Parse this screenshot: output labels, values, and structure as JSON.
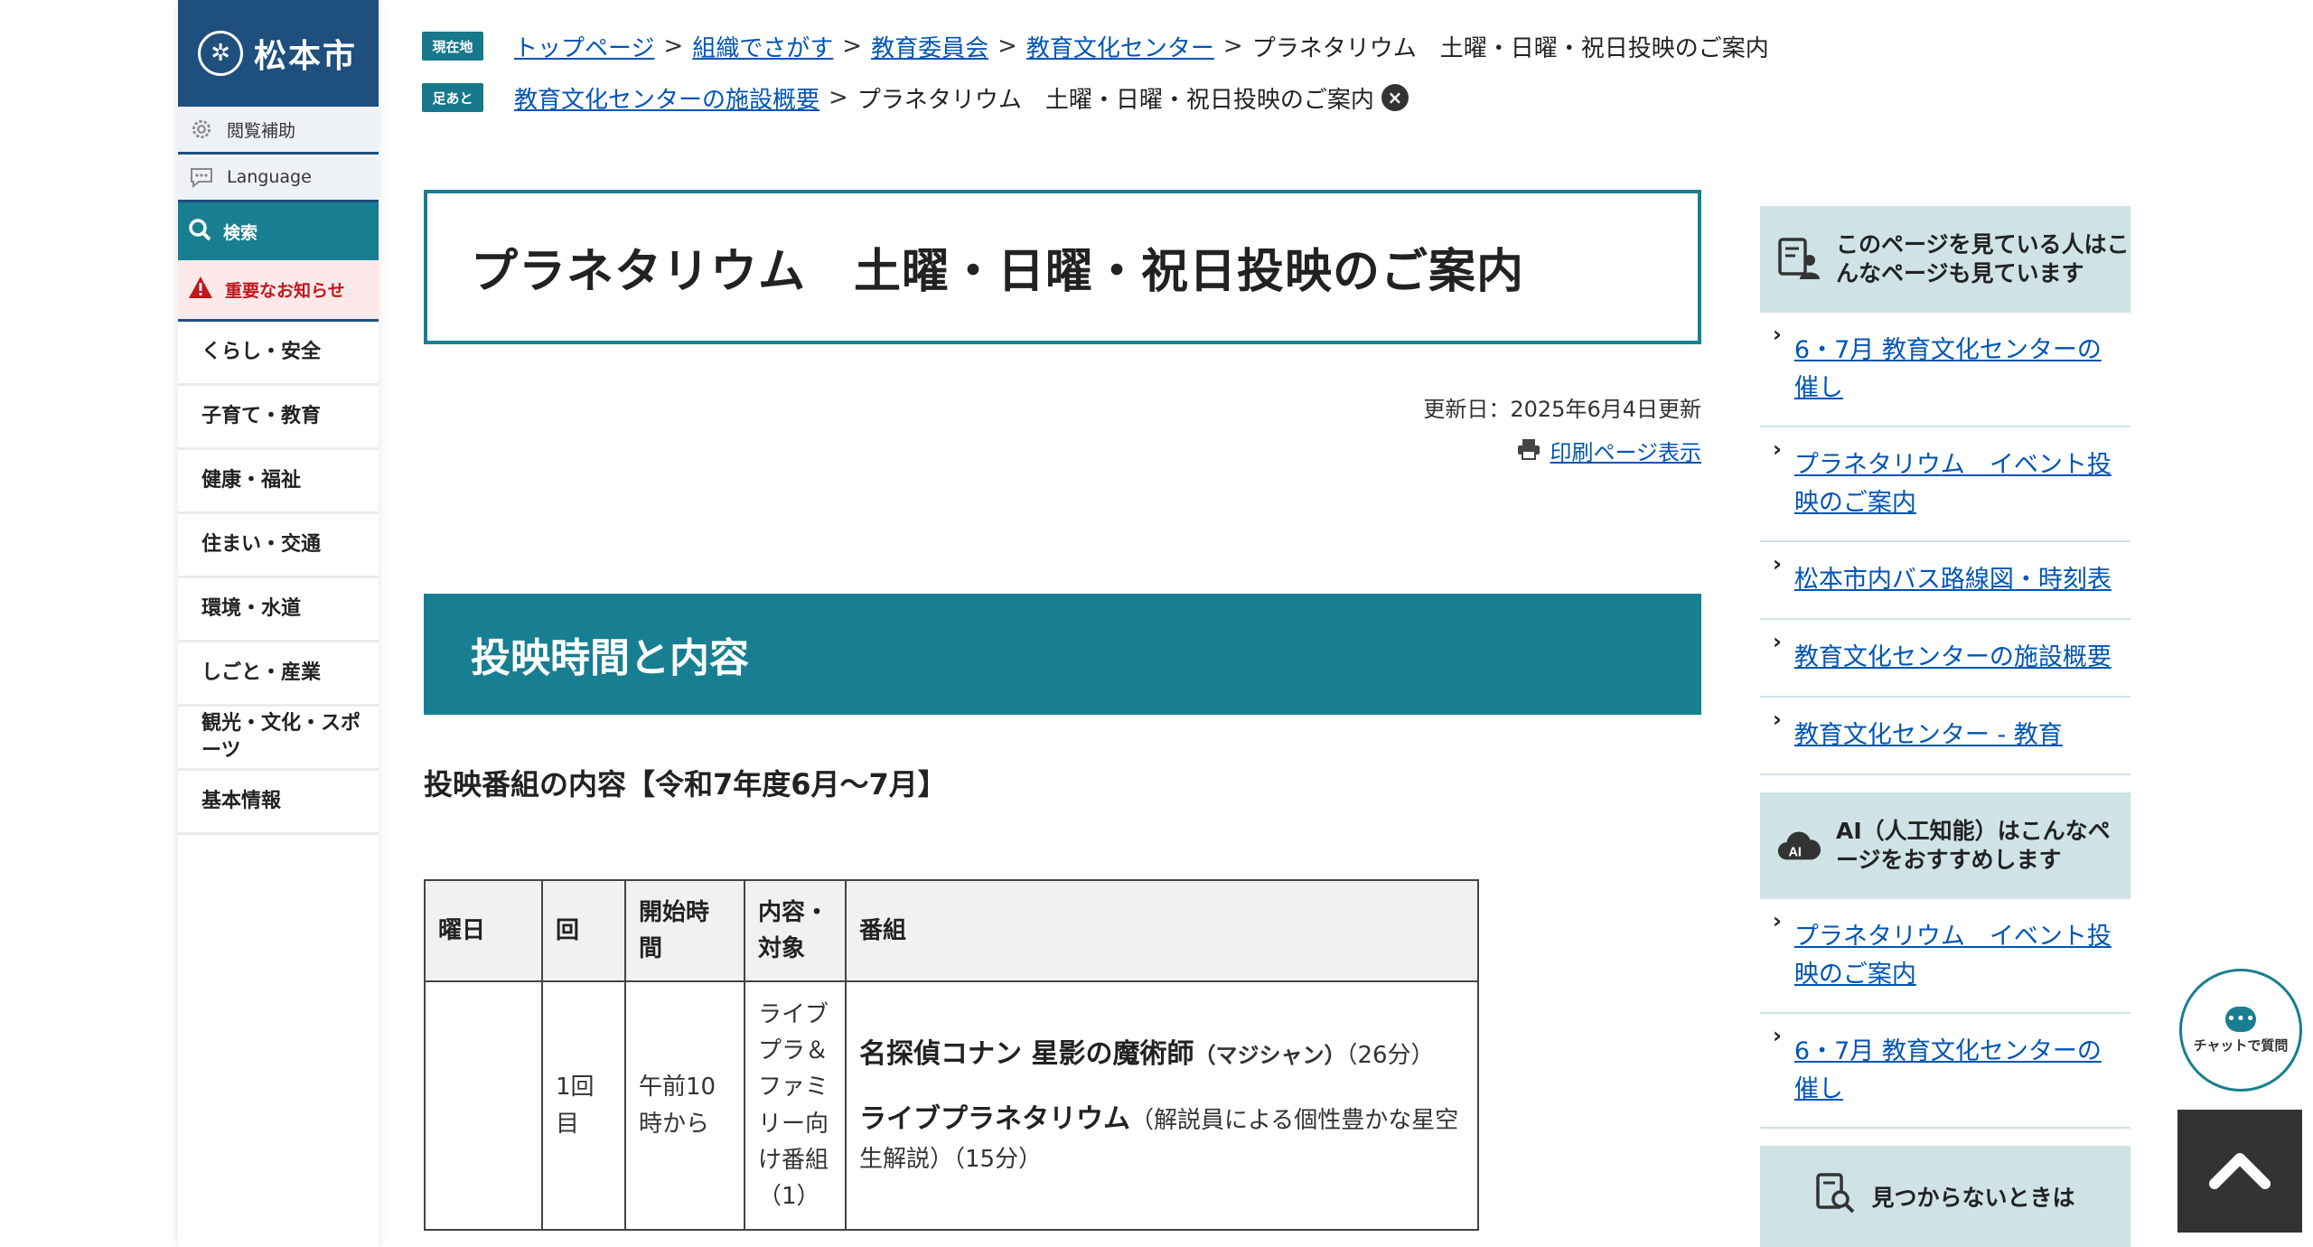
{
  "sidebar": {
    "logo_text": "松本市",
    "emblem_icon": "city-emblem-icon",
    "accessibility_label": "閲覧補助",
    "language_label": "Language",
    "search_label": "検索",
    "notice_label": "重要なお知らせ",
    "nav_items": [
      "くらし・安全",
      "子育て・教育",
      "健康・福祉",
      "住まい・交通",
      "環境・水道",
      "しごと・産業",
      "観光・文化・スポーツ",
      "基本情報"
    ]
  },
  "breadcrumb": {
    "current_badge": "現在地",
    "history_badge": "足あと",
    "current_path": [
      "トップページ",
      "組織でさがす",
      "教育委員会",
      "教育文化センター"
    ],
    "current_page": "プラネタリウム　土曜・日曜・祝日投映のご案内",
    "history_path": [
      "教育文化センターの施設概要"
    ],
    "history_page": "プラネタリウム　土曜・日曜・祝日投映のご案内",
    "separator": ">"
  },
  "page": {
    "title": "プラネタリウム　土曜・日曜・祝日投映のご案内",
    "updated": "更新日：2025年6月4日更新",
    "print_label": "印刷ページ表示",
    "section_title": "投映時間と内容",
    "subsection_title": "投映番組の内容【令和7年度6月～7月】"
  },
  "table": {
    "headers": [
      "曜日",
      "回",
      "開始時間",
      "内容・対象",
      "番組"
    ],
    "row1": {
      "day": "",
      "round": "1回目",
      "start": "午前10時から",
      "target": "ライブプラ＆ファミリー向け番組（1）",
      "program1_title": "名探偵コナン 星影の魔術師",
      "program1_ruby": "（マジシャン）",
      "program1_duration": "（26分）",
      "program2_title": "ライブプラネタリウム",
      "program2_desc": "（解説員による個性豊かな星空生解説）（15分）"
    }
  },
  "related": {
    "head_label": "このページを見ている人はこんなページも見ています",
    "links": [
      "6・7月 教育文化センターの催し",
      "プラネタリウム　イベント投映のご案内",
      "松本市内バス路線図・時刻表",
      "教育文化センターの施設概要",
      "教育文化センター - 教育"
    ]
  },
  "ai_recommend": {
    "head_label": "AI（人工知能）はこんなページをおすすめします",
    "links": [
      "プラネタリウム　イベント投映のご案内",
      "6・7月 教育文化センターの催し"
    ]
  },
  "notfound_label": "見つからないときは",
  "chat_label": "チャットで質問",
  "colors": {
    "brand_navy": "#1e4f7d",
    "teal": "#177f91",
    "link": "#0055b5",
    "alert_red": "#c0171c",
    "sidebar_box": "#cfe3e7"
  }
}
